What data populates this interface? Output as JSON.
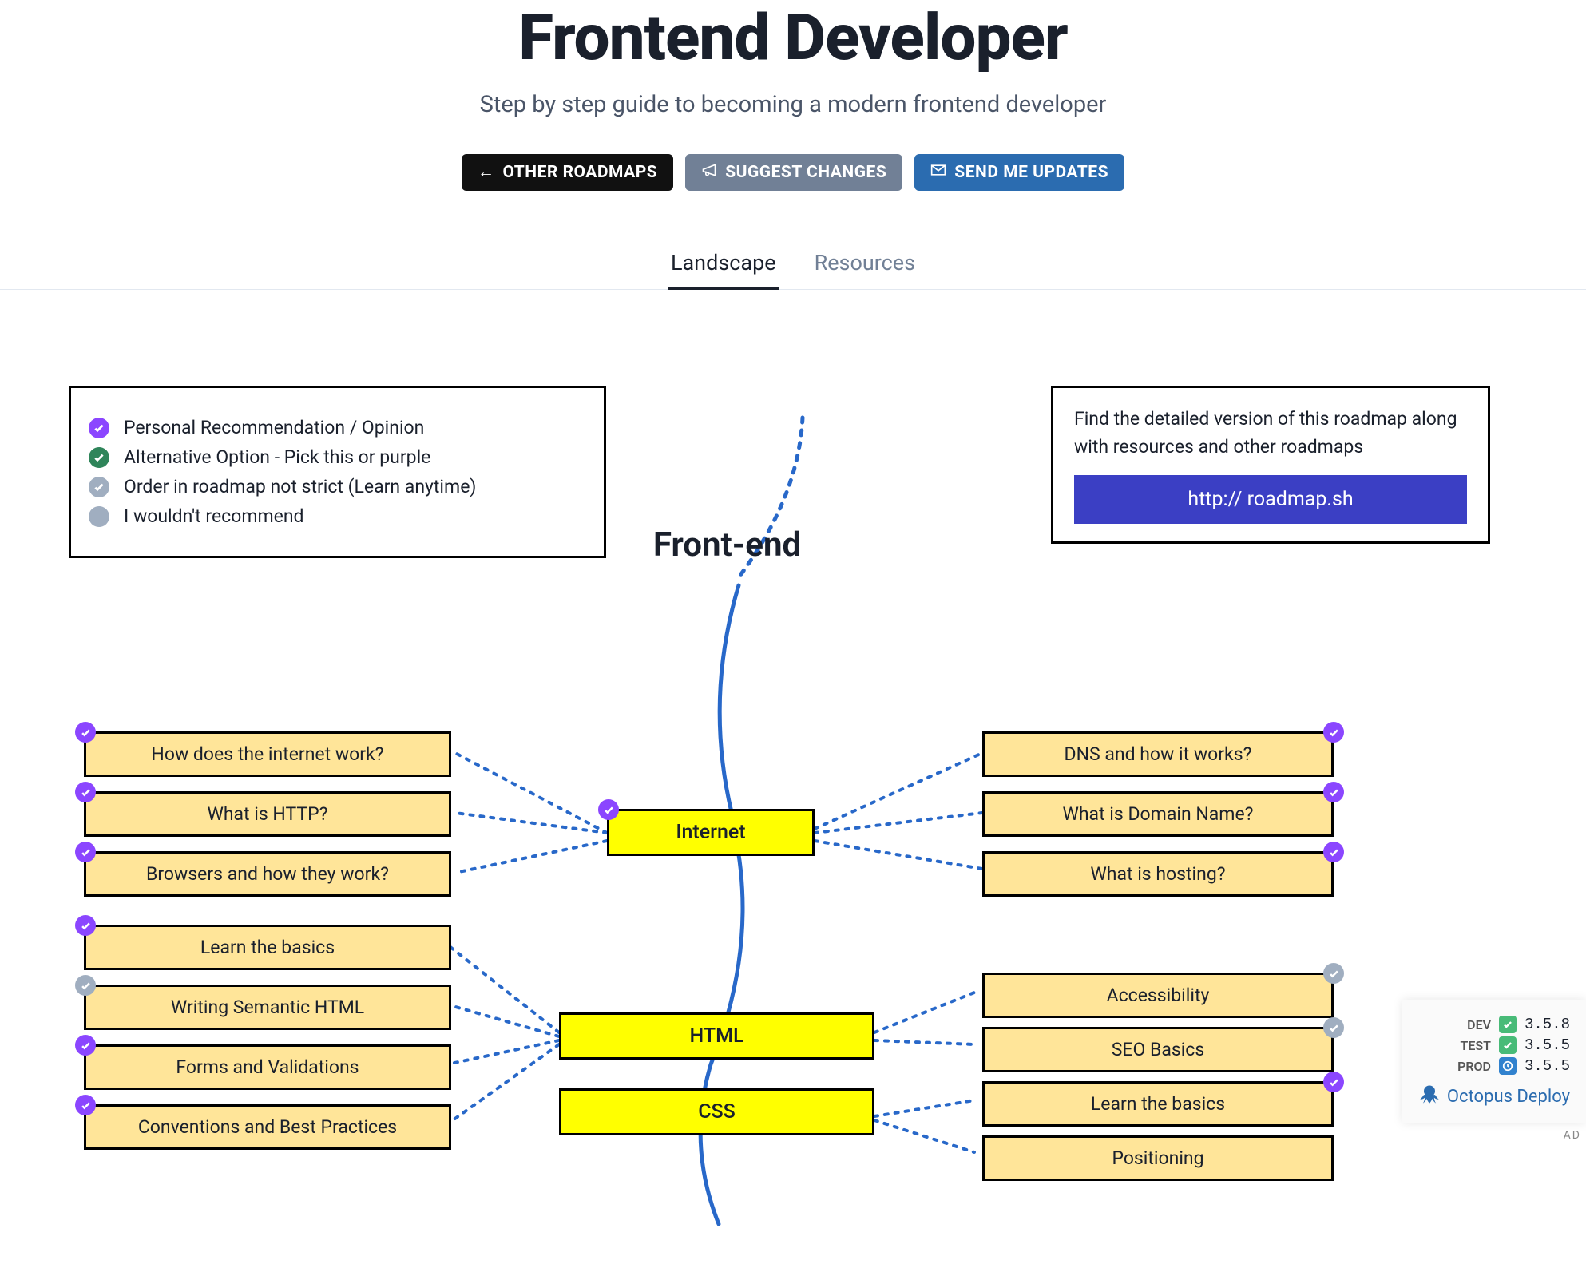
{
  "header": {
    "title": "Frontend Developer",
    "subtitle": "Step by step guide to becoming a modern frontend developer"
  },
  "buttons": {
    "other": "OTHER ROADMAPS",
    "suggest": "SUGGEST CHANGES",
    "updates": "SEND ME UPDATES"
  },
  "tabs": {
    "landscape": "Landscape",
    "resources": "Resources"
  },
  "legend": {
    "personal": "Personal Recommendation / Opinion",
    "alternative": "Alternative Option - Pick this or purple",
    "order": "Order in roadmap not strict (Learn anytime)",
    "not": "I wouldn't recommend"
  },
  "info": {
    "text": "Find the detailed version of this roadmap along with resources and other roadmaps",
    "url": "http:// roadmap.sh"
  },
  "diagram": {
    "root": "Front-end",
    "internet": {
      "label": "Internet",
      "left": [
        "How does the internet work?",
        "What is HTTP?",
        "Browsers and how they work?"
      ],
      "right": [
        "DNS and how it works?",
        "What is Domain Name?",
        "What is hosting?"
      ]
    },
    "html": {
      "label": "HTML",
      "left": [
        "Learn the basics",
        "Writing Semantic HTML",
        "Forms and Validations",
        "Conventions and Best Practices"
      ],
      "right": [
        "Accessibility",
        "SEO Basics",
        "Learn the basics",
        "Positioning"
      ]
    },
    "css": {
      "label": "CSS"
    }
  },
  "ad": {
    "env": [
      {
        "name": "DEV",
        "status": "ok",
        "ver": "3.5.8"
      },
      {
        "name": "TEST",
        "status": "ok",
        "ver": "3.5.5"
      },
      {
        "name": "PROD",
        "status": "pending",
        "ver": "3.5.5"
      }
    ],
    "brand": "Octopus Deploy",
    "tag": "AD"
  }
}
